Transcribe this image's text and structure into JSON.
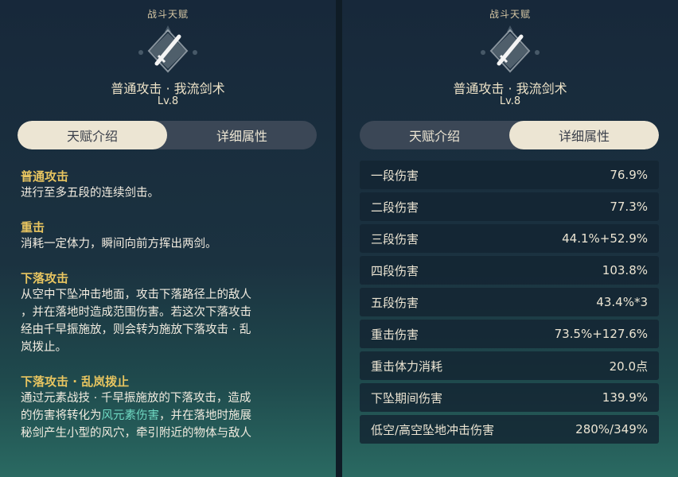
{
  "left": {
    "header": "战斗天赋",
    "attack_name": "普通攻击 · 我流剑术",
    "level": "Lv.8",
    "tabs": [
      "天赋介绍",
      "详细属性"
    ],
    "sections": [
      {
        "title": "普通攻击",
        "lines": [
          "进行至多五段的连续剑击。"
        ]
      },
      {
        "title": "重击",
        "lines": [
          "消耗一定体力，瞬间向前方挥出两剑。"
        ]
      },
      {
        "title": "下落攻击",
        "lines": [
          "从空中下坠冲击地面，攻击下落路径上的敌人",
          "，并在落地时造成范围伤害。若这次下落攻击",
          "经由千早振施放，则会转为施放下落攻击 · 乱",
          "岚拨止。"
        ]
      },
      {
        "title": "下落攻击 · 乱岚拨止",
        "line1": "通过元素战技 · 千早振施放的下落攻击，造成",
        "line2_a": "的伤害将转化为",
        "line2_green": "风元素伤害",
        "line2_b": "，并在落地时施展",
        "line3": "秘剑产生小型的风穴，牵引附近的物体与敌人"
      }
    ]
  },
  "right": {
    "header": "战斗天赋",
    "attack_name": "普通攻击 · 我流剑术",
    "level": "Lv.8",
    "tabs": [
      "天赋介绍",
      "详细属性"
    ],
    "rows": [
      {
        "label": "一段伤害",
        "value": "76.9%"
      },
      {
        "label": "二段伤害",
        "value": "77.3%"
      },
      {
        "label": "三段伤害",
        "value": "44.1%+52.9%"
      },
      {
        "label": "四段伤害",
        "value": "103.8%"
      },
      {
        "label": "五段伤害",
        "value": "43.4%*3"
      },
      {
        "label": "重击伤害",
        "value": "73.5%+127.6%"
      },
      {
        "label": "重击体力消耗",
        "value": "20.0点"
      },
      {
        "label": "下坠期间伤害",
        "value": "139.9%"
      },
      {
        "label": "低空/高空坠地冲击伤害",
        "value": "280%/349%"
      }
    ]
  },
  "colors": {
    "accent_gold": "#e8c560",
    "anemo_green": "#6fd9c2",
    "cream": "#ece5d3"
  },
  "icons": {
    "emblem": "sword-talent-icon"
  }
}
